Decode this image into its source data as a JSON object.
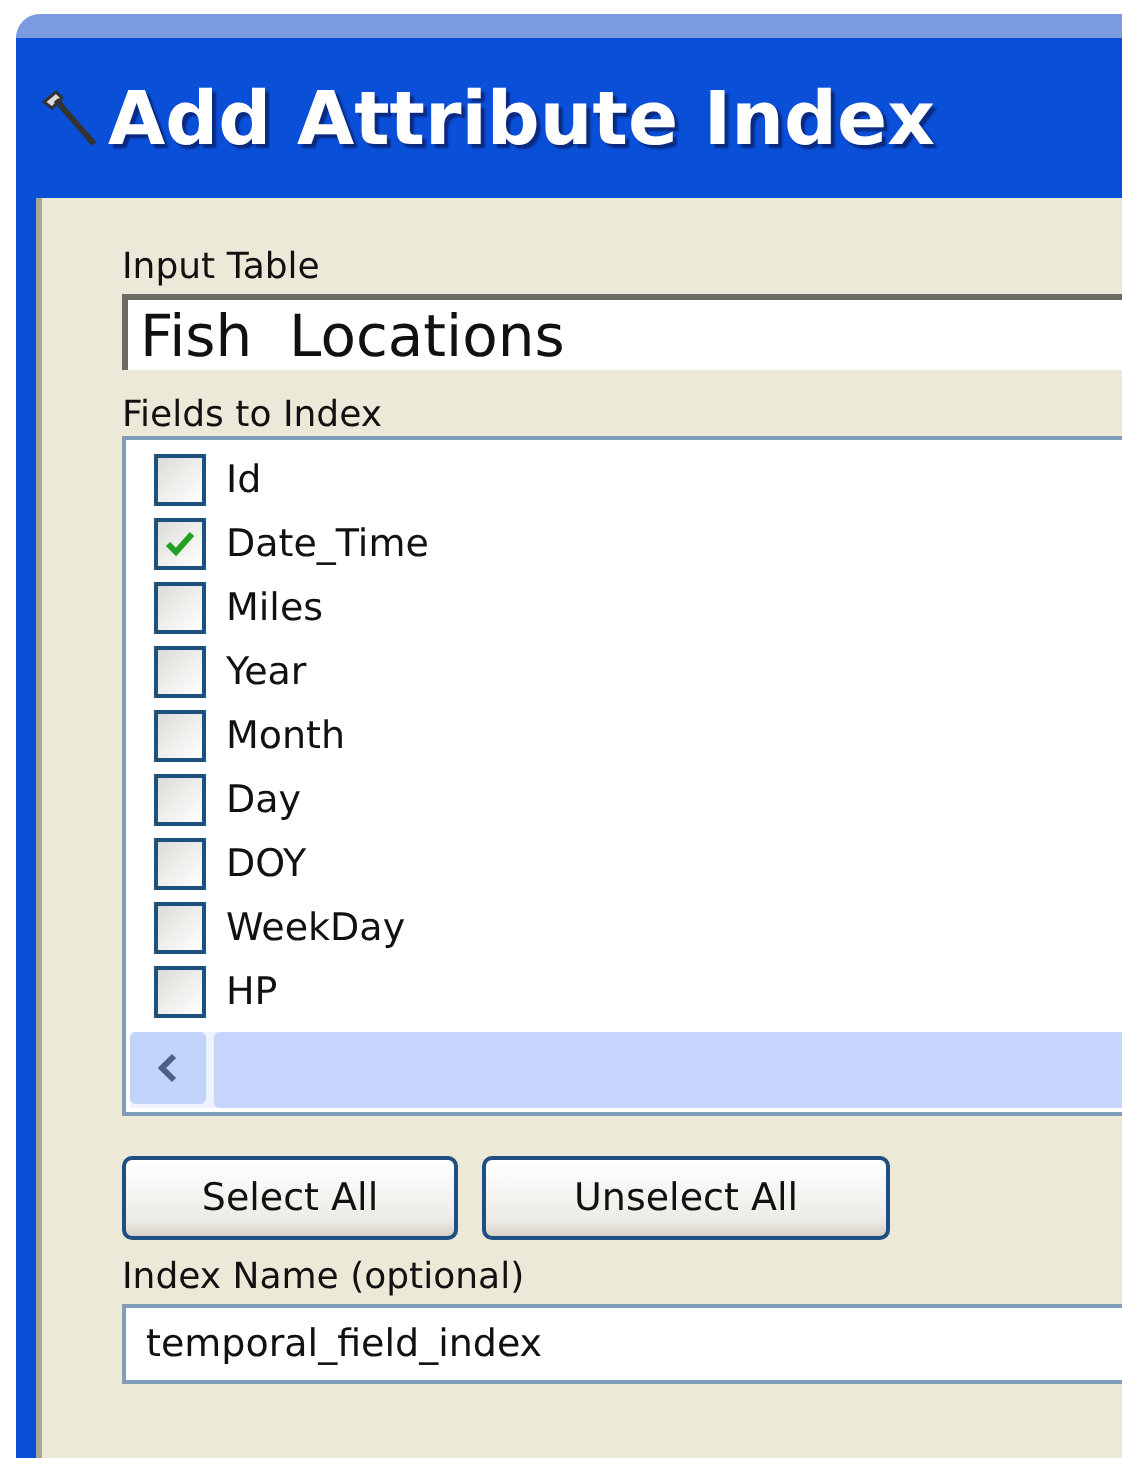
{
  "window": {
    "title": "Add Attribute Index"
  },
  "input_table": {
    "label": "Input Table",
    "value": "Fish  Locations"
  },
  "fields": {
    "label": "Fields to Index",
    "items": [
      {
        "name": "Id",
        "checked": false
      },
      {
        "name": "Date_Time",
        "checked": true
      },
      {
        "name": "Miles",
        "checked": false
      },
      {
        "name": "Year",
        "checked": false
      },
      {
        "name": "Month",
        "checked": false
      },
      {
        "name": "Day",
        "checked": false
      },
      {
        "name": "DOY",
        "checked": false
      },
      {
        "name": "WeekDay",
        "checked": false
      },
      {
        "name": "HP",
        "checked": false
      }
    ]
  },
  "buttons": [
    "Select All",
    "Unselect All"
  ],
  "index_name": {
    "label": "Index Name (optional)",
    "value": "temporal_field_index"
  }
}
